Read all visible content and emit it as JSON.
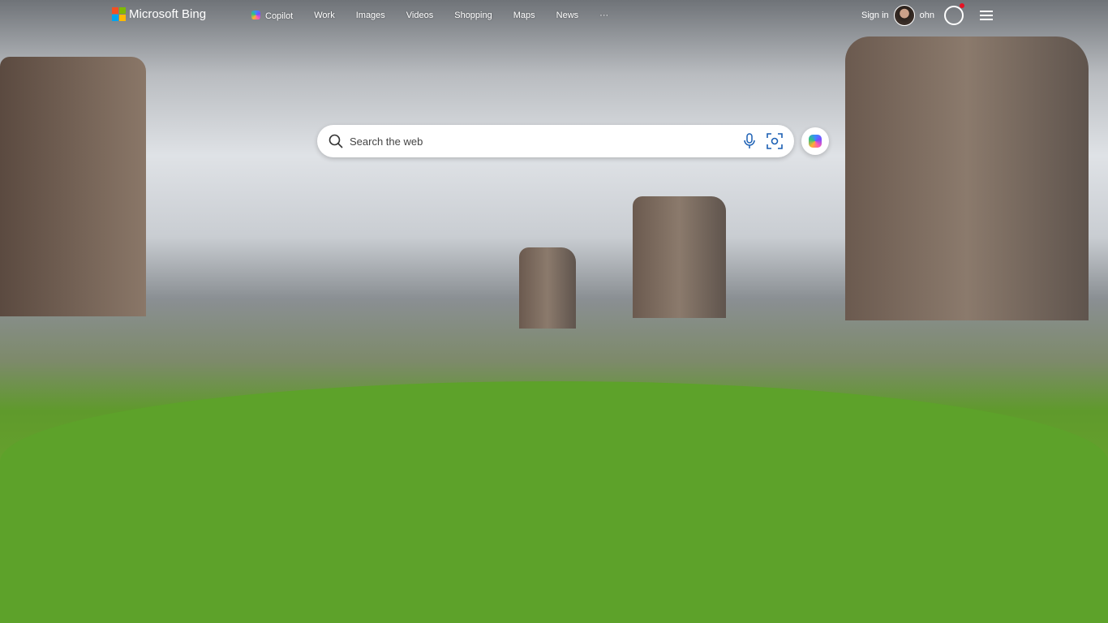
{
  "header": {
    "brand": "Microsoft Bing",
    "nav": [
      "Copilot",
      "Work",
      "Images",
      "Videos",
      "Shopping",
      "Maps",
      "News",
      "···"
    ],
    "sign_in": "Sign in",
    "user_name": "ohn"
  },
  "search": {
    "placeholder": "Search the web"
  },
  "colors": {
    "notification": "#e81123"
  }
}
